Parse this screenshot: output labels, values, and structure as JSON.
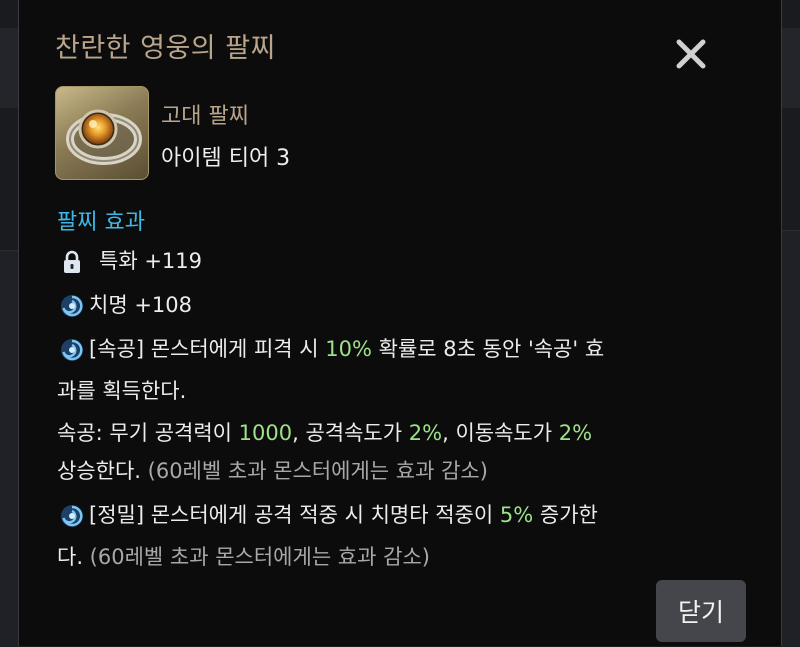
{
  "dialog": {
    "title": "찬란한 영웅의 팔찌",
    "close_icon": "close-icon"
  },
  "item": {
    "type": "고대 팔찌",
    "tier": "아이템 티어 3",
    "thumbnail_icon": "bracelet-icon"
  },
  "effects": {
    "section_title": "팔찌 효과",
    "stat1": {
      "icon": "lock-icon",
      "label": "특화 +119"
    },
    "stat2": {
      "icon": "swirl-icon",
      "label": "치명 +108"
    },
    "effect1": {
      "icon": "swirl-icon",
      "line1_pre": "[속공] 몬스터에게 피격 시 ",
      "line1_hl": "10%",
      "line1_post": " 확률로 8초 동안 '속공' 효",
      "line2": "과를 획득한다.",
      "line3_pre": "속공: 무기 공격력이 ",
      "line3_hl1": "1000",
      "line3_mid1": ", 공격속도가 ",
      "line3_hl2": "2%",
      "line3_mid2": ", 이동속도가 ",
      "line3_hl3": "2%",
      "line4_pre": "상승한다. ",
      "line4_note": "(60레벨 초과 몬스터에게는 효과 감소)"
    },
    "effect2": {
      "icon": "swirl-icon",
      "line1_pre": "[정밀] 몬스터에게 공격 적중 시 치명타 적중이 ",
      "line1_hl": "5%",
      "line1_post": " 증가한",
      "line2_pre": "다. ",
      "line2_note": "(60레벨 초과 몬스터에게는 효과 감소)"
    }
  },
  "footer": {
    "close_button": "닫기"
  },
  "colors": {
    "title": "#b9a58c",
    "section": "#3fb7e6",
    "highlight": "#9fe08a",
    "note": "#a8a8a8",
    "background": "#0c0c0d"
  }
}
